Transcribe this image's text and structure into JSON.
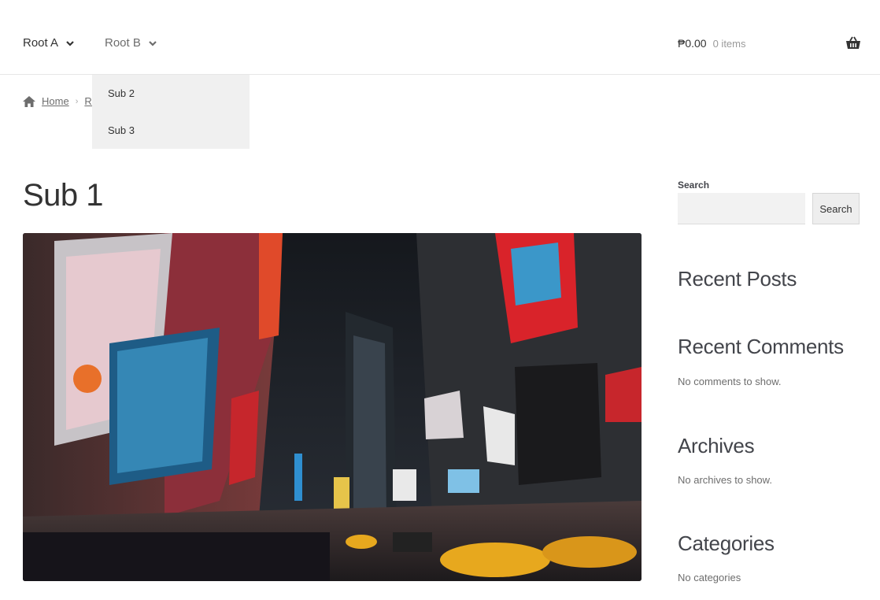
{
  "nav": {
    "root_a": "Root A",
    "root_b": "Root B",
    "dropdown": [
      "Sub 2",
      "Sub 3"
    ]
  },
  "cart": {
    "amount": "₱0.00",
    "count": "0 items"
  },
  "breadcrumb": {
    "home": "Home",
    "partial": "Ro"
  },
  "page": {
    "title": "Sub 1"
  },
  "sidebar": {
    "search_label": "Search",
    "search_button": "Search",
    "recent_posts": "Recent Posts",
    "recent_comments": "Recent Comments",
    "recent_comments_text": "No comments to show.",
    "archives": "Archives",
    "archives_text": "No archives to show.",
    "categories": "Categories",
    "categories_text": "No categories"
  },
  "colors": {
    "text": "#43454b",
    "dropdown_bg": "#f0f0f0",
    "input_bg": "#f2f2f2"
  }
}
